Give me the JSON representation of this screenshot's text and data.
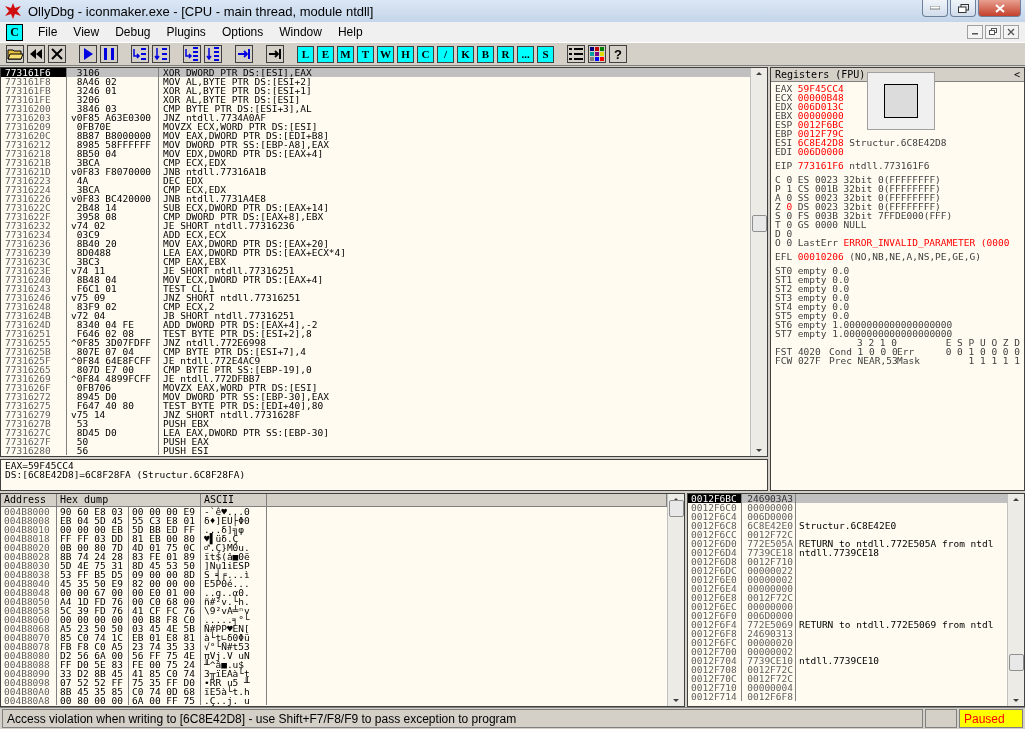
{
  "title_bar": {
    "title": "OllyDbg - iconmaker.exe - [CPU - main thread, module ntdll]"
  },
  "menu_bar": {
    "child_icon": "C",
    "items": [
      {
        "label": "File"
      },
      {
        "label": "View"
      },
      {
        "label": "Debug"
      },
      {
        "label": "Plugins"
      },
      {
        "label": "Options"
      },
      {
        "label": "Window"
      },
      {
        "label": "Help"
      }
    ]
  },
  "toolbar": {
    "icons": [
      {
        "kind": "open"
      },
      {
        "kind": "restart"
      },
      {
        "kind": "close"
      },
      {
        "kind": "run"
      },
      {
        "kind": "pause"
      },
      {
        "kind": "step-into"
      },
      {
        "kind": "step-over"
      },
      {
        "kind": "trace-into"
      },
      {
        "kind": "trace-over"
      },
      {
        "kind": "till-return"
      },
      {
        "kind": "goto"
      }
    ],
    "windows": [
      {
        "label": "L"
      },
      {
        "label": "E"
      },
      {
        "label": "M"
      },
      {
        "label": "T"
      },
      {
        "label": "W"
      },
      {
        "label": "H"
      },
      {
        "label": "C"
      },
      {
        "label": "/"
      },
      {
        "label": "K"
      },
      {
        "label": "B"
      },
      {
        "label": "R"
      },
      {
        "label": "..."
      },
      {
        "label": "S"
      }
    ],
    "tools": [
      {
        "kind": "list"
      },
      {
        "kind": "colors"
      },
      {
        "kind": "help",
        "label": "?"
      }
    ]
  },
  "disassembly": {
    "rows": [
      {
        "address": "773161F6",
        "hex": "3106",
        "command": "XOR DWORD PTR DS:[ESI],EAX",
        "selected": true
      },
      {
        "address": "773161F8",
        "hex": "8A46 02",
        "command": "MOV AL,BYTE PTR DS:[ESI+2]",
        "selected": false
      },
      {
        "address": "773161FB",
        "hex": "3246 01",
        "command": "XOR AL,BYTE PTR DS:[ESI+1]",
        "selected": false
      },
      {
        "address": "773161FE",
        "hex": "3206",
        "command": "XOR AL,BYTE PTR DS:[ESI]",
        "selected": false
      },
      {
        "address": "77316200",
        "hex": "3846 03",
        "command": "CMP BYTE PTR DS:[ESI+3],AL",
        "selected": false
      },
      {
        "address": "77316203",
        "jump": "v",
        "hex": "0F85 A63E0300",
        "command": "JNZ ntdll.7734A0AF",
        "selected": false
      },
      {
        "address": "77316209",
        "hex": "0FB70E",
        "command": "MOVZX ECX,WORD PTR DS:[ESI]",
        "selected": false
      },
      {
        "address": "7731620C",
        "hex": "8B87 B8000000",
        "command": "MOV EAX,DWORD PTR DS:[EDI+B8]",
        "selected": false
      },
      {
        "address": "77316212",
        "hex": "8985 58FFFFFF",
        "command": "MOV DWORD PTR SS:[EBP-A8],EAX",
        "selected": false
      },
      {
        "address": "77316218",
        "hex": "8B50 04",
        "command": "MOV EDX,DWORD PTR DS:[EAX+4]",
        "selected": false
      },
      {
        "address": "7731621B",
        "hex": "3BCA",
        "command": "CMP ECX,EDX",
        "selected": false
      },
      {
        "address": "7731621D",
        "jump": "v",
        "hex": "0F83 F8070000",
        "command": "JNB ntdll.77316A1B",
        "selected": false
      },
      {
        "address": "77316223",
        "hex": "4A",
        "command": "DEC EDX",
        "selected": false
      },
      {
        "address": "77316224",
        "hex": "3BCA",
        "command": "CMP ECX,EDX",
        "selected": false
      },
      {
        "address": "77316226",
        "jump": "v",
        "hex": "0F83 BC420000",
        "command": "JNB ntdll.7731A4E8",
        "selected": false
      },
      {
        "address": "7731622C",
        "hex": "2B48 14",
        "command": "SUB ECX,DWORD PTR DS:[EAX+14]",
        "selected": false
      },
      {
        "address": "7731622F",
        "hex": "3958 08",
        "command": "CMP DWORD PTR DS:[EAX+8],EBX",
        "selected": false
      },
      {
        "address": "77316232",
        "jump": "v",
        "hex": "74 02",
        "command": "JE SHORT ntdll.77316236",
        "selected": false
      },
      {
        "address": "77316234",
        "hex": "03C9",
        "command": "ADD ECX,ECX",
        "selected": false
      },
      {
        "address": "77316236",
        "hex": "8B40 20",
        "command": "MOV EAX,DWORD PTR DS:[EAX+20]",
        "selected": false
      },
      {
        "address": "77316239",
        "hex": "8D0488",
        "command": "LEA EAX,DWORD PTR DS:[EAX+ECX*4]",
        "selected": false
      },
      {
        "address": "7731623C",
        "hex": "3BC3",
        "command": "CMP EAX,EBX",
        "selected": false
      },
      {
        "address": "7731623E",
        "jump": "v",
        "hex": "74 11",
        "command": "JE SHORT ntdll.77316251",
        "selected": false
      },
      {
        "address": "77316240",
        "hex": "8B48 04",
        "command": "MOV ECX,DWORD PTR DS:[EAX+4]",
        "selected": false
      },
      {
        "address": "77316243",
        "hex": "F6C1 01",
        "command": "TEST CL,1",
        "selected": false
      },
      {
        "address": "77316246",
        "jump": "v",
        "hex": "75 09",
        "command": "JNZ SHORT ntdll.77316251",
        "selected": false
      },
      {
        "address": "77316248",
        "hex": "83F9 02",
        "command": "CMP ECX,2",
        "selected": false
      },
      {
        "address": "7731624B",
        "jump": "v",
        "hex": "72 04",
        "command": "JB SHORT ntdll.77316251",
        "selected": false
      },
      {
        "address": "7731624D",
        "hex": "8340 04 FE",
        "command": "ADD DWORD PTR DS:[EAX+4],-2",
        "selected": false
      },
      {
        "address": "77316251",
        "hex": "F646 02 08",
        "command": "TEST BYTE PTR DS:[ESI+2],8",
        "selected": false
      },
      {
        "address": "77316255",
        "jump": "^",
        "hex": "0F85 3D07FDFF",
        "command": "JNZ ntdll.772E6998",
        "selected": false
      },
      {
        "address": "7731625B",
        "hex": "807E 07 04",
        "command": "CMP BYTE PTR DS:[ESI+7],4",
        "selected": false
      },
      {
        "address": "7731625F",
        "jump": "^",
        "hex": "0F84 64E8FCFF",
        "command": "JE ntdll.772E4AC9",
        "selected": false
      },
      {
        "address": "77316265",
        "hex": "807D E7 00",
        "command": "CMP BYTE PTR SS:[EBP-19],0",
        "selected": false
      },
      {
        "address": "77316269",
        "jump": "^",
        "hex": "0F84 4899FCFF",
        "command": "JE ntdll.772DFBB7",
        "selected": false
      },
      {
        "address": "7731626F",
        "hex": "0FB706",
        "command": "MOVZX EAX,WORD PTR DS:[ESI]",
        "selected": false
      },
      {
        "address": "77316272",
        "hex": "8945 D0",
        "command": "MOV DWORD PTR SS:[EBP-30],EAX",
        "selected": false
      },
      {
        "address": "77316275",
        "hex": "F647 40 80",
        "command": "TEST BYTE PTR DS:[EDI+40],80",
        "selected": false
      },
      {
        "address": "77316279",
        "jump": "v",
        "hex": "75 14",
        "command": "JNZ SHORT ntdll.7731628F",
        "selected": false
      },
      {
        "address": "7731627B",
        "hex": "53",
        "command": "PUSH EBX",
        "selected": false
      },
      {
        "address": "7731627C",
        "hex": "8D45 D0",
        "command": "LEA EAX,DWORD PTR SS:[EBP-30]",
        "selected": false
      },
      {
        "address": "7731627F",
        "hex": "50",
        "command": "PUSH EAX",
        "selected": false
      },
      {
        "address": "77316280",
        "hex": "56",
        "command": "PUSH ESI",
        "selected": false
      }
    ]
  },
  "info_pane": {
    "lines": [
      "EAX=59F45CC4",
      "DS:[6C8E42D8]=6C8F28FA (Structur.6C8F28FA)"
    ]
  },
  "registers": {
    "title": "Registers (FPU)",
    "collapse": "<",
    "general": [
      {
        "name": "EAX",
        "value": "59F45CC4",
        "changed": true
      },
      {
        "name": "ECX",
        "value": "00000B48",
        "changed": true
      },
      {
        "name": "EDX",
        "value": "006D013C",
        "changed": true
      },
      {
        "name": "EBX",
        "value": "00000000",
        "changed": true
      },
      {
        "name": "ESP",
        "value": "0012F6BC",
        "changed": true
      },
      {
        "name": "EBP",
        "value": "0012F79C",
        "changed": true
      },
      {
        "name": "ESI",
        "value": "6C8E42D8",
        "changed": true,
        "comment": "Structur.6C8E42D8"
      },
      {
        "name": "EDI",
        "value": "006D0000",
        "changed": true
      }
    ],
    "eip": {
      "name": "EIP",
      "value": "773161F6",
      "changed": true,
      "comment": "ntdll.773161F6"
    },
    "flags": [
      {
        "name": "C",
        "value": "0",
        "changed": false,
        "segment": "ES 0023 32bit 0(FFFFFFFF)"
      },
      {
        "name": "P",
        "value": "1",
        "changed": false,
        "segment": "CS 001B 32bit 0(FFFFFFFF)"
      },
      {
        "name": "A",
        "value": "0",
        "changed": false,
        "segment": "SS 0023 32bit 0(FFFFFFFF)"
      },
      {
        "name": "Z",
        "value": "0",
        "changed": true,
        "segment": "DS 0023 32bit 0(FFFFFFFF)"
      },
      {
        "name": "S",
        "value": "0",
        "changed": false,
        "segment": "FS 003B 32bit 7FFDE000(FFF)"
      },
      {
        "name": "T",
        "value": "0",
        "changed": false,
        "segment": "GS 0000 NULL"
      },
      {
        "name": "D",
        "value": "0",
        "changed": false
      },
      {
        "name": "O",
        "value": "0",
        "changed": false,
        "last_error_label": "LastErr",
        "last_error": "ERROR_INVALID_PARAMETER (0000"
      }
    ],
    "efl": {
      "name": "EFL",
      "value": "00010206",
      "changed": true,
      "comment": "(NO,NB,NE,A,NS,PE,GE,G)"
    },
    "fpu": [
      {
        "name": "ST0",
        "tag": "empty",
        "value": "0.0"
      },
      {
        "name": "ST1",
        "tag": "empty",
        "value": "0.0"
      },
      {
        "name": "ST2",
        "tag": "empty",
        "value": "0.0"
      },
      {
        "name": "ST3",
        "tag": "empty",
        "value": "0.0"
      },
      {
        "name": "ST4",
        "tag": "empty",
        "value": "0.0"
      },
      {
        "name": "ST5",
        "tag": "empty",
        "value": "0.0"
      },
      {
        "name": "ST6",
        "tag": "empty",
        "value": "1.0000000000000000000"
      },
      {
        "name": "ST7",
        "tag": "empty",
        "value": "1.0000000000000000000"
      }
    ],
    "cond_bits": "3 2 1 0",
    "err_bits": "E S P U O Z D",
    "fst": {
      "label": "FST 4020",
      "cond": "Cond 1 0 0 0",
      "err_label": "Err",
      "err": "0 0 1 0 0 0 0"
    },
    "fcw": {
      "label": "FCW 027F",
      "prec": "Prec NEAR,53",
      "mask_label": "Mask",
      "mask": "1 1 1 1 1"
    }
  },
  "dump": {
    "columns": [
      "Address",
      "Hex dump",
      "ASCII"
    ],
    "rows": [
      {
        "address": "004B8000",
        "hex": [
          "90 60 E8 03",
          "00 00 00 E9"
        ],
        "ascii": "-`ê♥...Θ"
      },
      {
        "address": "004B8008",
        "hex": [
          "EB 04 5D 45",
          "55 C3 E8 01"
        ],
        "ascii": "δ♦]EU├Φ0"
      },
      {
        "address": "004B8010",
        "hex": [
          "00 00 00 EB",
          "5D BB ED FF"
        ],
        "ascii": "...δ]╗φ"
      },
      {
        "address": "004B8018",
        "hex": [
          "FF FF 03 DD",
          "81 EB 00 80"
        ],
        "ascii": "♥▌üδ.Ç"
      },
      {
        "address": "004B8020",
        "hex": [
          "0B 00 80 7D",
          "4D 01 75 0C"
        ],
        "ascii": "♂.Ç}M0u."
      },
      {
        "address": "004B8028",
        "hex": [
          "8B 74 24 28",
          "83 FE 01 89"
        ],
        "ascii": "ït$(â■0ë"
      },
      {
        "address": "004B8030",
        "hex": [
          "5D 4E 75 31",
          "8D 45 53 50"
        ],
        "ascii": "]Nu1iESP"
      },
      {
        "address": "004B8038",
        "hex": [
          "53 FF B5 D5",
          "09 00 00 8D"
        ],
        "ascii": "S ╡╒...ì"
      },
      {
        "address": "004B8040",
        "hex": [
          "45 35 50 E9",
          "82 00 00 00"
        ],
        "ascii": "E5PΘé..."
      },
      {
        "address": "004B8048",
        "hex": [
          "00 00 67 00",
          "00 E0 01 00"
        ],
        "ascii": "..g..α0."
      },
      {
        "address": "004B8050",
        "hex": [
          "A4 1D FD 76",
          "00 C0 68 00"
        ],
        "ascii": "ñ#²v.└h."
      },
      {
        "address": "004B8058",
        "hex": [
          "5C 39 FD 76",
          "41 CF FC 76"
        ],
        "ascii": "\\9²vA╧ⁿv"
      },
      {
        "address": "004B8060",
        "hex": [
          "00 00 00 00",
          "00 B8 F8 C0"
        ],
        "ascii": ".....╕°└"
      },
      {
        "address": "004B8068",
        "hex": [
          "A5 23 50 50",
          "03 45 4E 5B"
        ],
        "ascii": "Ñ#PP♥EN["
      },
      {
        "address": "004B8070",
        "hex": [
          "85 C0 74 1C",
          "EB 01 E8 81"
        ],
        "ascii": "à└t∟δ0Φü"
      },
      {
        "address": "004B8078",
        "hex": [
          "FB F8 C0 A5",
          "23 74 35 33"
        ],
        "ascii": "√°└Ñ#t53"
      },
      {
        "address": "004B8080",
        "hex": [
          "D2 56 6A 00",
          "56 FF 75 4E"
        ],
        "ascii": "πVj.V uN"
      },
      {
        "address": "004B8088",
        "hex": [
          "FF D0 5E 83",
          "FE 00 75 24"
        ],
        "ascii": "╨^â■.u$"
      },
      {
        "address": "004B8090",
        "hex": [
          "33 D2 8B 45",
          "41 85 C0 74"
        ],
        "ascii": "3╥ïEAà└t"
      },
      {
        "address": "004B8098",
        "hex": [
          "07 52 52 FF",
          "75 35 FF D0"
        ],
        "ascii": "•RR u5 ╨"
      },
      {
        "address": "004B80A0",
        "hex": [
          "8B 45 35 85",
          "C0 74 0D 68"
        ],
        "ascii": "ïE5à└t.h"
      },
      {
        "address": "004B80A8",
        "hex": [
          "00 80 00 00",
          "6A 00 FF 75"
        ],
        "ascii": ".Ç..j. u"
      }
    ]
  },
  "stack": {
    "rows": [
      {
        "address": "0012F6BC",
        "value": "246903A3",
        "selected": true
      },
      {
        "address": "0012F6C0",
        "value": "00000000",
        "selected": false
      },
      {
        "address": "0012F6C4",
        "value": "006D0000",
        "selected": false
      },
      {
        "address": "0012F6C8",
        "value": "6C8E42E0",
        "comment": "Structur.6C8E42E0",
        "selected": false
      },
      {
        "address": "0012F6CC",
        "value": "0012F72C",
        "selected": false
      },
      {
        "address": "0012F6D0",
        "value": "772E505A",
        "comment": "RETURN to ntdll.772E505A from ntdl",
        "selected": false
      },
      {
        "address": "0012F6D4",
        "value": "7739CE18",
        "comment": "ntdll.7739CE18",
        "selected": false
      },
      {
        "address": "0012F6D8",
        "value": "0012F710",
        "selected": false
      },
      {
        "address": "0012F6DC",
        "value": "00000022",
        "selected": false
      },
      {
        "address": "0012F6E0",
        "value": "00000002",
        "selected": false
      },
      {
        "address": "0012F6E4",
        "value": "00000000",
        "selected": false
      },
      {
        "address": "0012F6E8",
        "value": "0012F72C",
        "selected": false
      },
      {
        "address": "0012F6EC",
        "value": "00000000",
        "selected": false
      },
      {
        "address": "0012F6F0",
        "value": "006D0000",
        "selected": false
      },
      {
        "address": "0012F6F4",
        "value": "772E5069",
        "comment": "RETURN to ntdll.772E5069 from ntdl",
        "selected": false
      },
      {
        "address": "0012F6F8",
        "value": "24690313",
        "selected": false
      },
      {
        "address": "0012F6FC",
        "value": "00000020",
        "selected": false
      },
      {
        "address": "0012F700",
        "value": "00000002",
        "selected": false
      },
      {
        "address": "0012F704",
        "value": "7739CE10",
        "comment": "ntdll.7739CE10",
        "selected": false
      },
      {
        "address": "0012F708",
        "value": "0012F72C",
        "selected": false
      },
      {
        "address": "0012F70C",
        "value": "0012F72C",
        "selected": false
      },
      {
        "address": "0012F710",
        "value": "00000004",
        "selected": false
      },
      {
        "address": "0012F714",
        "value": "0012F6F8",
        "selected": false
      }
    ]
  },
  "status_bar": {
    "message": "Access violation when writing to [6C8E42D8] - use Shift+F7/F8/F9 to pass exception to program",
    "state": "Paused"
  }
}
